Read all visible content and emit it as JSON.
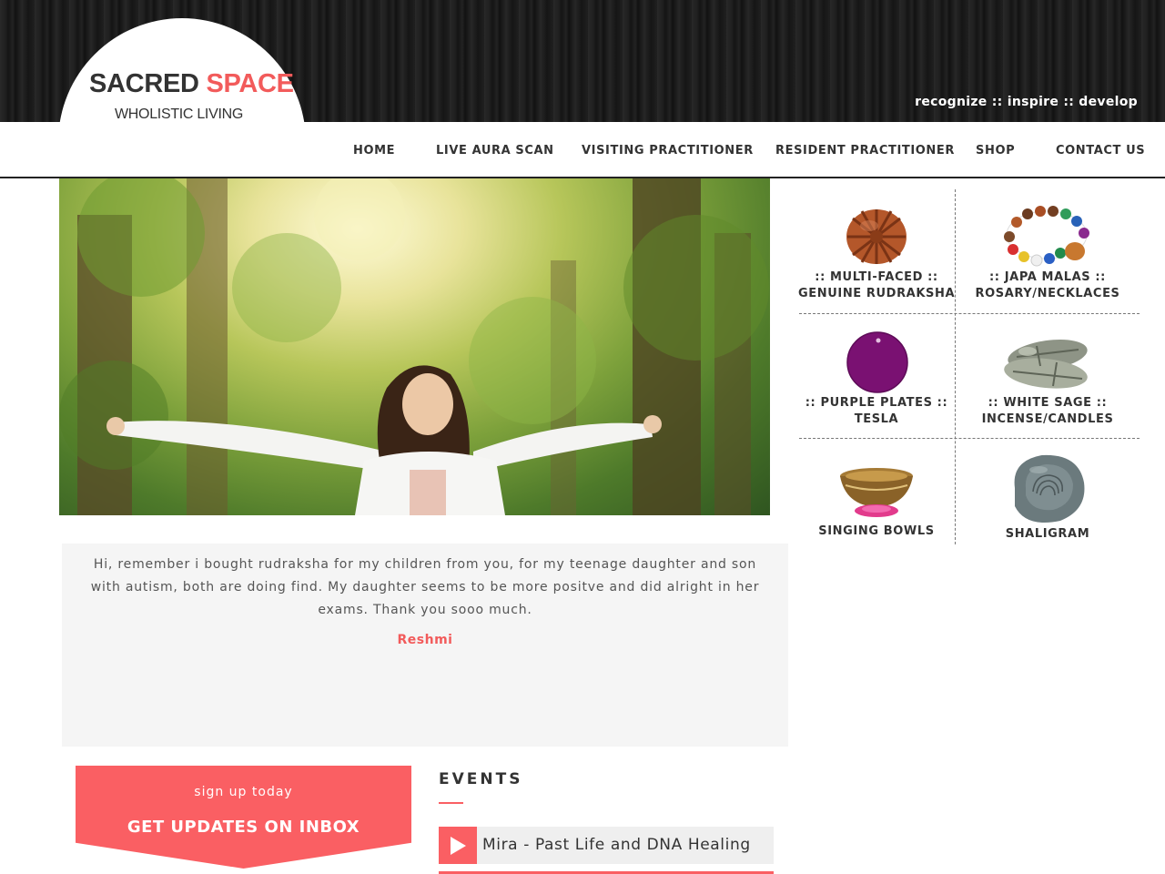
{
  "header": {
    "logo": {
      "word1": "SACRED",
      "word2": "SPACE",
      "subtitle": "WHOLISTIC LIVING"
    },
    "tagline": "recognize :: inspire :: develop"
  },
  "nav": {
    "items": [
      {
        "label": "HOME"
      },
      {
        "label": "LIVE AURA SCAN"
      },
      {
        "label": "VISITING PRACTITIONER"
      },
      {
        "label": "RESIDENT PRACTITIONER"
      },
      {
        "label": "SHOP"
      },
      {
        "label": "CONTACT US"
      }
    ]
  },
  "testimonial": {
    "text": "Hi, remember i bought rudraksha for my children from you, for my teenage daughter and son with autism, both are doing find. My daughter seems to be more positve and did alright in her exams. Thank you sooo much.",
    "author": "Reshmi"
  },
  "signup": {
    "small": "sign up today",
    "big": "GET UPDATES ON INBOX"
  },
  "events": {
    "title": "EVENTS",
    "items": [
      {
        "label": "Mira - Past Life and DNA Healing"
      }
    ]
  },
  "shop": {
    "items": [
      {
        "line1": ":: MULTI-FACED ::",
        "line2": "GENUINE RUDRAKSHA",
        "icon": "rudraksha-bead-icon"
      },
      {
        "line1": ":: JAPA MALAS ::",
        "line2": "ROSARY/NECKLACES",
        "icon": "bead-bracelet-icon"
      },
      {
        "line1": ":: PURPLE PLATES ::",
        "line2": "TESLA",
        "icon": "purple-plate-icon"
      },
      {
        "line1": ":: WHITE SAGE ::",
        "line2": "INCENSE/CANDLES",
        "icon": "sage-bundle-icon"
      },
      {
        "line1": "SINGING BOWLS",
        "line2": "",
        "icon": "singing-bowl-icon"
      },
      {
        "line1": "SHALIGRAM",
        "line2": "",
        "icon": "shaligram-stone-icon"
      }
    ]
  },
  "colors": {
    "accent": "#fa5f63",
    "logo_accent": "#f25b5b",
    "purple_plate": "#7a1172"
  }
}
